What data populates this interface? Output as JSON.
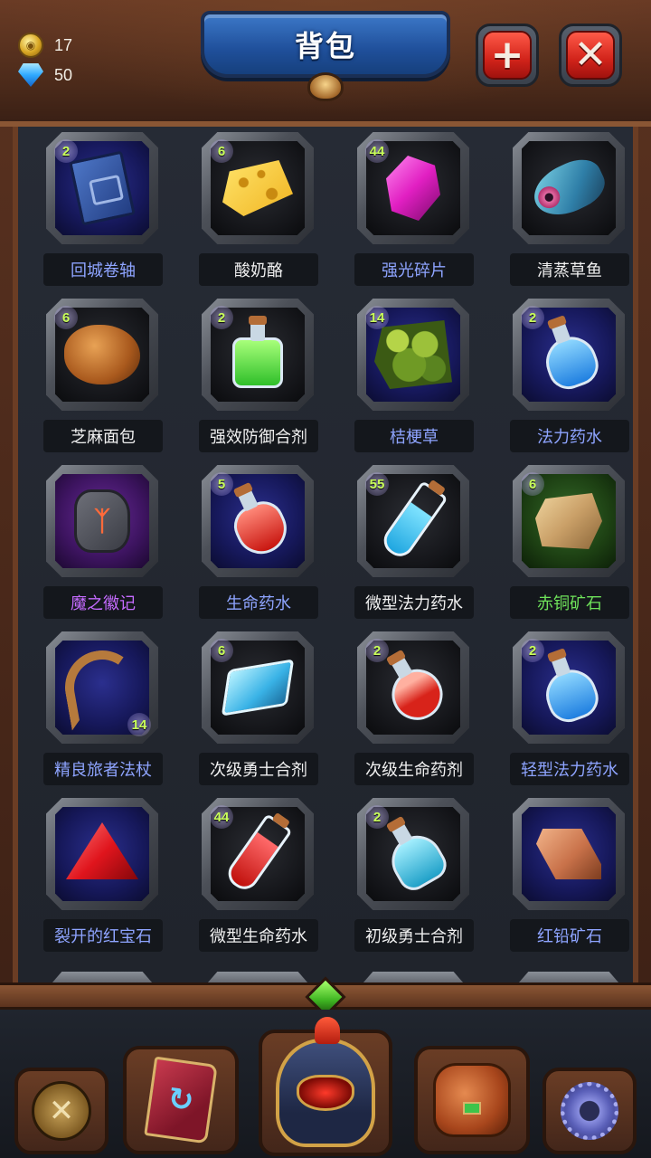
{
  "header": {
    "title": "背包",
    "coins": "17",
    "gems": "50",
    "add_label": "+",
    "close_label": "✕"
  },
  "items": [
    {
      "name": "回城卷轴",
      "count": "2",
      "rarity": "blue",
      "name_color": "#8ea4ff",
      "icon": "book-icon"
    },
    {
      "name": "酸奶酪",
      "count": "6",
      "rarity": "dark",
      "name_color": "#f0f0f0",
      "icon": "cheese-icon"
    },
    {
      "name": "强光碎片",
      "count": "44",
      "rarity": "dark",
      "name_color": "#8ea4ff",
      "icon": "crystal-icon"
    },
    {
      "name": "清蒸草鱼",
      "count": "",
      "rarity": "dark",
      "name_color": "#f0f0f0",
      "icon": "fish-icon"
    },
    {
      "name": "芝麻面包",
      "count": "6",
      "rarity": "dark",
      "name_color": "#f0f0f0",
      "icon": "bread-icon"
    },
    {
      "name": "强效防御合剂",
      "count": "2",
      "rarity": "dark",
      "name_color": "#f0f0f0",
      "icon": "green-potion-icon"
    },
    {
      "name": "桔梗草",
      "count": "14",
      "rarity": "blue",
      "name_color": "#8ea4ff",
      "icon": "herb-icon"
    },
    {
      "name": "法力药水",
      "count": "2",
      "rarity": "blue",
      "name_color": "#8ea4ff",
      "icon": "blue-potion-icon"
    },
    {
      "name": "魔之徽记",
      "count": "",
      "rarity": "purple",
      "name_color": "#c56bff",
      "icon": "rune-icon"
    },
    {
      "name": "生命药水",
      "count": "5",
      "rarity": "blue",
      "name_color": "#8ea4ff",
      "icon": "red-potion-icon"
    },
    {
      "name": "微型法力药水",
      "count": "55",
      "rarity": "dark",
      "name_color": "#f0f0f0",
      "icon": "blue-vial-icon"
    },
    {
      "name": "赤铜矿石",
      "count": "6",
      "rarity": "green",
      "name_color": "#6ee25a",
      "icon": "ore-icon"
    },
    {
      "name": "精良旅者法杖",
      "count": "14",
      "count_pos": "br",
      "rarity": "blue",
      "name_color": "#8ea4ff",
      "icon": "staff-icon"
    },
    {
      "name": "次级勇士合剂",
      "count": "6",
      "rarity": "dark",
      "name_color": "#f0f0f0",
      "icon": "cyan-flask-icon"
    },
    {
      "name": "次级生命药剂",
      "count": "2",
      "rarity": "dark",
      "name_color": "#f0f0f0",
      "icon": "red-flask-icon"
    },
    {
      "name": "轻型法力药水",
      "count": "2",
      "rarity": "blue",
      "name_color": "#8ea4ff",
      "icon": "blue-potion-icon"
    },
    {
      "name": "裂开的红宝石",
      "count": "",
      "rarity": "blue",
      "name_color": "#8ea4ff",
      "icon": "ruby-icon"
    },
    {
      "name": "微型生命药水",
      "count": "44",
      "rarity": "dark",
      "name_color": "#f0f0f0",
      "icon": "red-vial-icon"
    },
    {
      "name": "初级勇士合剂",
      "count": "2",
      "rarity": "dark",
      "name_color": "#f0f0f0",
      "icon": "cyan-bottle-icon"
    },
    {
      "name": "红铅矿石",
      "count": "",
      "rarity": "blue",
      "name_color": "#8ea4ff",
      "icon": "ingot-icon"
    }
  ],
  "nav": [
    {
      "id": "battle",
      "icon": "crossed-swords-icon"
    },
    {
      "id": "spellbook",
      "icon": "spellbook-icon"
    },
    {
      "id": "hero",
      "icon": "helmet-icon"
    },
    {
      "id": "backpack",
      "icon": "backpack-icon"
    },
    {
      "id": "settings",
      "icon": "gear-icon"
    }
  ],
  "colors": {
    "frame_wood": "#6a3b25",
    "banner_blue": "#1f4f9a",
    "button_red": "#d1231a",
    "count_text": "#c9ff5a"
  }
}
